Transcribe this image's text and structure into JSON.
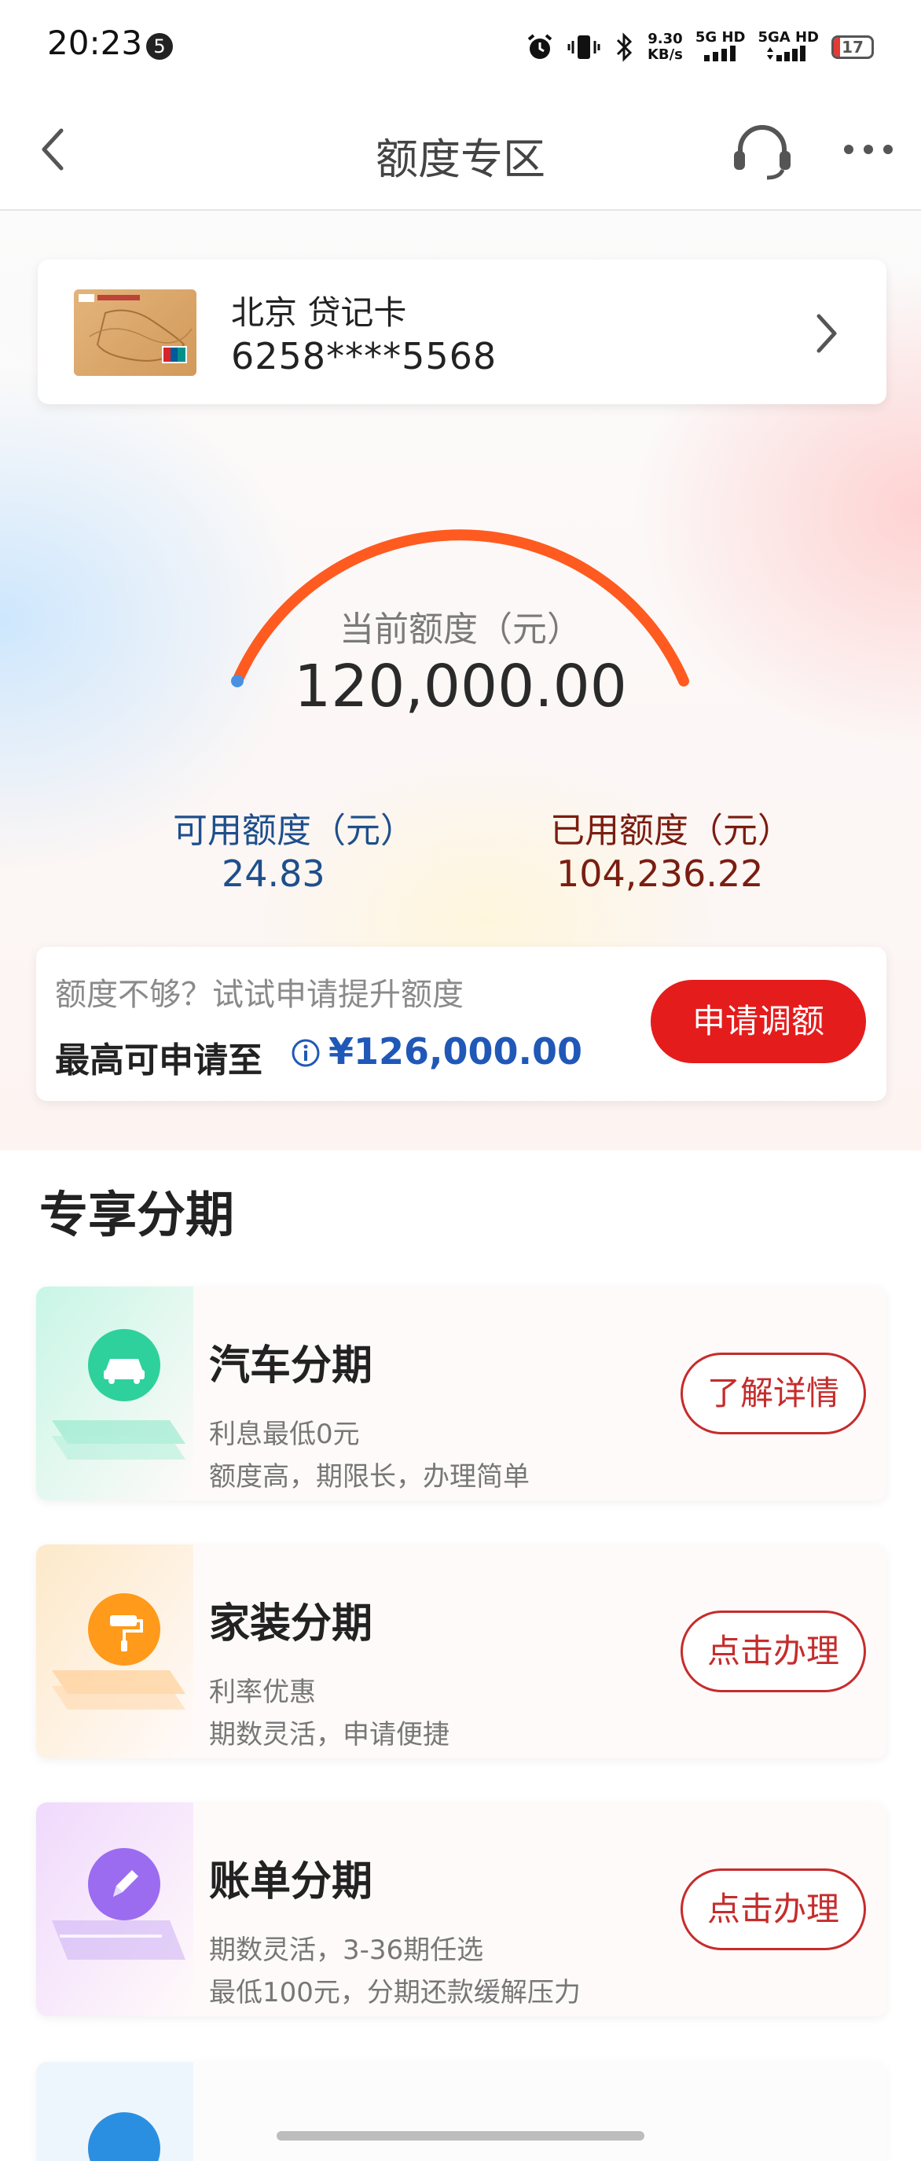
{
  "status_bar": {
    "time": "20:23",
    "notification_count": "5",
    "net_speed_top": "9.30",
    "net_speed_bottom": "KB/s",
    "sim1": "5G HD",
    "sim2": "5GA HD",
    "battery": "17"
  },
  "header": {
    "title": "额度专区"
  },
  "card": {
    "name": "北京 贷记卡",
    "number": "6258****5568"
  },
  "credit": {
    "current_label": "当前额度（元）",
    "current_value": "120,000.00",
    "available_label": "可用额度（元）",
    "available_value": "24.83",
    "used_label": "已用额度（元）",
    "used_value": "104,236.22",
    "used_fraction": 0.9998,
    "gauge_color": "#ff5a1f",
    "available_dot_color": "#4a90e2"
  },
  "raise": {
    "hint": "额度不够？试试申请提升额度",
    "prefix": "最高可申请至",
    "amount": "¥126,000.00",
    "button": "申请调额"
  },
  "section": {
    "title": "专享分期"
  },
  "promos": [
    {
      "title": "汽车分期",
      "sub1": "利息最低0元",
      "sub2": "额度高，期限长，办理简单",
      "button": "了解详情",
      "icon": "car-icon",
      "color": "#2ed19b"
    },
    {
      "title": "家装分期",
      "sub1": "利率优惠",
      "sub2": "期数灵活，申请便捷",
      "button": "点击办理",
      "icon": "paint-roller-icon",
      "color": "#ff9a1a"
    },
    {
      "title": "账单分期",
      "sub1": "期数灵活，3-36期任选",
      "sub2": "最低100元，分期还款缓解压力",
      "button": "点击办理",
      "icon": "pencil-icon",
      "color": "#9b6cf0"
    }
  ]
}
